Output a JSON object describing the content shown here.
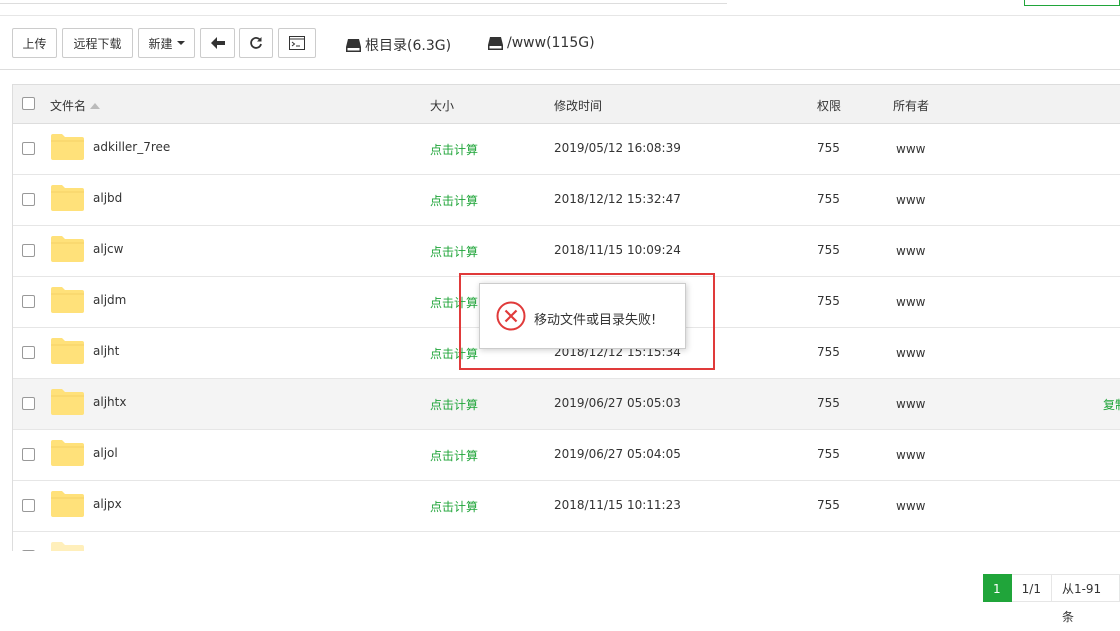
{
  "toolbar": {
    "upload_label": "上传",
    "remote_download_label": "远程下载",
    "new_label": "新建",
    "disks": [
      {
        "label": "根目录(6.3G)"
      },
      {
        "label": "/www(115G)"
      }
    ]
  },
  "table": {
    "headers": {
      "name": "文件名",
      "size": "大小",
      "mtime": "修改时间",
      "perm": "权限",
      "owner": "所有者"
    },
    "rows": [
      {
        "name": "adkiller_7ree",
        "size": "点击计算",
        "mtime": "2019/05/12 16:08:39",
        "perm": "755",
        "owner": "www"
      },
      {
        "name": "aljbd",
        "size": "点击计算",
        "mtime": "2018/12/12 15:32:47",
        "perm": "755",
        "owner": "www"
      },
      {
        "name": "aljcw",
        "size": "点击计算",
        "mtime": "2018/11/15 10:09:24",
        "perm": "755",
        "owner": "www"
      },
      {
        "name": "aljdm",
        "size": "点击计算",
        "mtime": "",
        "perm": "755",
        "owner": "www"
      },
      {
        "name": "aljht",
        "size": "点击计算",
        "mtime": "2018/12/12 15:15:34",
        "perm": "755",
        "owner": "www"
      },
      {
        "name": "aljhtx",
        "size": "点击计算",
        "mtime": "2019/06/27 05:05:03",
        "perm": "755",
        "owner": "www",
        "op": "复制"
      },
      {
        "name": "aljol",
        "size": "点击计算",
        "mtime": "2019/06/27 05:04:05",
        "perm": "755",
        "owner": "www"
      },
      {
        "name": "aljpx",
        "size": "点击计算",
        "mtime": "2018/11/15 10:11:23",
        "perm": "755",
        "owner": "www"
      }
    ]
  },
  "pagination": {
    "current": "1",
    "pages": "1/1",
    "range": "从1-91条"
  },
  "toast": {
    "message": "移动文件或目录失败!"
  },
  "colors": {
    "accent": "#20a53a",
    "error": "#e03a3a",
    "folder": "#ffe17a"
  }
}
